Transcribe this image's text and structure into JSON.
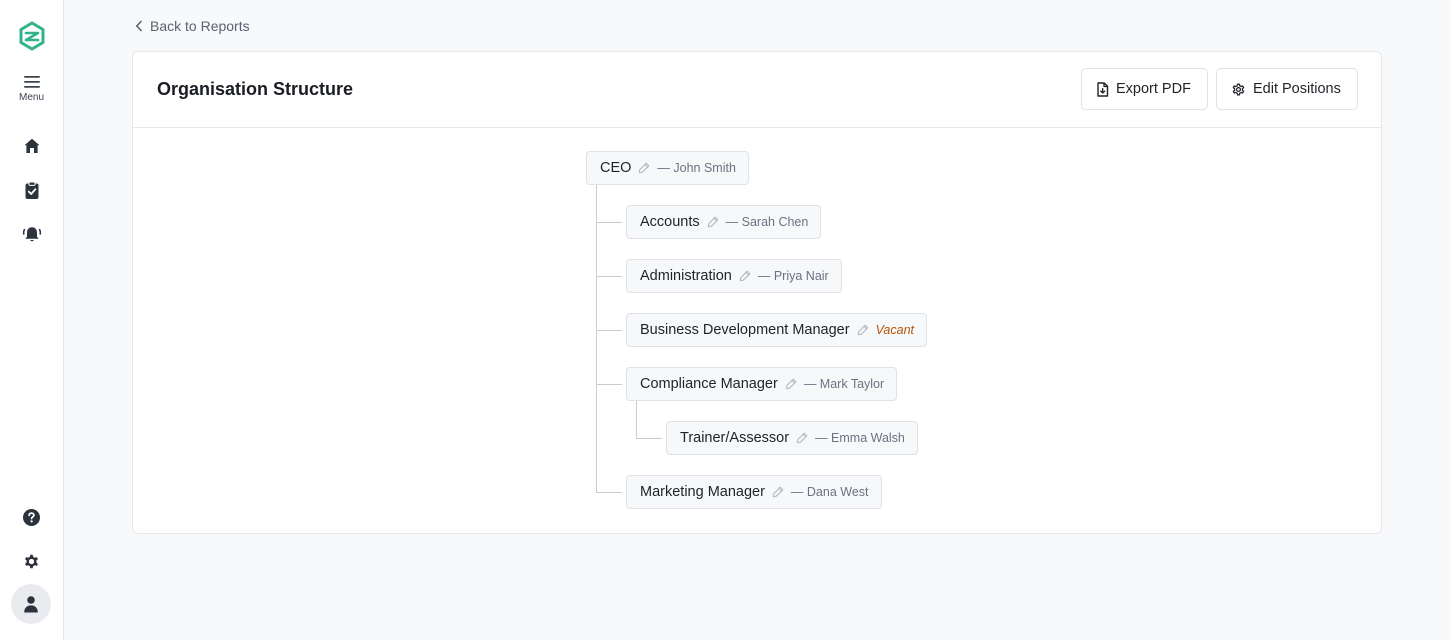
{
  "sidebar": {
    "menu_label": "Menu",
    "icons": {
      "logo": "brand-logo-icon",
      "menu": "hamburger-icon",
      "home": "home-icon",
      "tasks": "clipboard-check-icon",
      "alerts": "bell-alert-icon",
      "help": "help-circle-icon",
      "settings": "gear-icon",
      "profile": "user-icon"
    }
  },
  "back_link": {
    "label": "Back to Reports",
    "icon": "chevron-left-icon"
  },
  "header": {
    "title": "Organisation Structure",
    "export_label": "Export PDF",
    "export_icon": "file-download-icon",
    "edit_label": "Edit Positions",
    "edit_icon": "gear-icon"
  },
  "tree": {
    "root": {
      "title": "CEO",
      "holder": "— John Smith"
    },
    "children": [
      {
        "title": "Accounts",
        "holder": "— Sarah Chen"
      },
      {
        "title": "Administration",
        "holder": "— Priya Nair"
      },
      {
        "title": "Business Development Manager",
        "status": "Vacant"
      },
      {
        "title": "Compliance Manager",
        "holder": "— Mark Taylor"
      },
      {
        "title": "Trainer/Assessor",
        "holder": "— Emma Walsh"
      },
      {
        "title": "Marketing Manager",
        "holder": "— Dana West"
      }
    ]
  },
  "colors": {
    "brand": "#2fb38a",
    "vacant": "#b45309",
    "connector": "#c9ccd2"
  }
}
